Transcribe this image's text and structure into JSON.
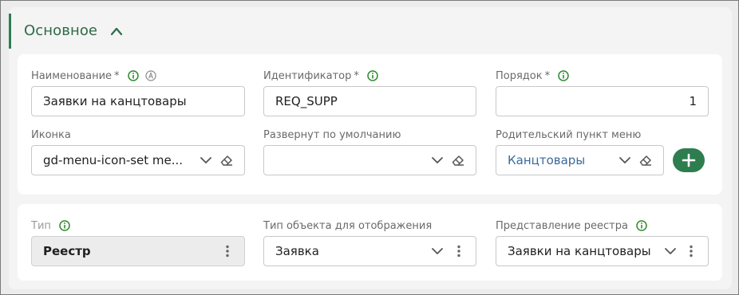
{
  "section": {
    "title": "Основное"
  },
  "fields": {
    "name": {
      "label": "Наименование",
      "required": "*",
      "value": "Заявки на канцтовары"
    },
    "identifier": {
      "label": "Идентификатор",
      "required": "*",
      "value": "REQ_SUPP"
    },
    "order": {
      "label": "Порядок",
      "required": "*",
      "value": "1"
    },
    "icon": {
      "label": "Иконка",
      "value": "gd-menu-icon-set me..."
    },
    "expanded": {
      "label": "Развернут по умолчанию",
      "value": ""
    },
    "parent": {
      "label": "Родительский пункт меню",
      "value": "Канцтовары"
    },
    "type": {
      "label": "Тип",
      "value": "Реестр"
    },
    "object_type": {
      "label": "Тип объекта для отображения",
      "value": "Заявка"
    },
    "registry_view": {
      "label": "Представление реестра",
      "value": "Заявки на канцтовары"
    }
  },
  "colors": {
    "accent": "#2e7d4f",
    "link": "#3a6a9a"
  },
  "icons": [
    "chevron-up-icon",
    "info-icon",
    "auto-icon",
    "chevron-down-icon",
    "eraser-icon",
    "plus-icon",
    "more-vertical-icon"
  ]
}
